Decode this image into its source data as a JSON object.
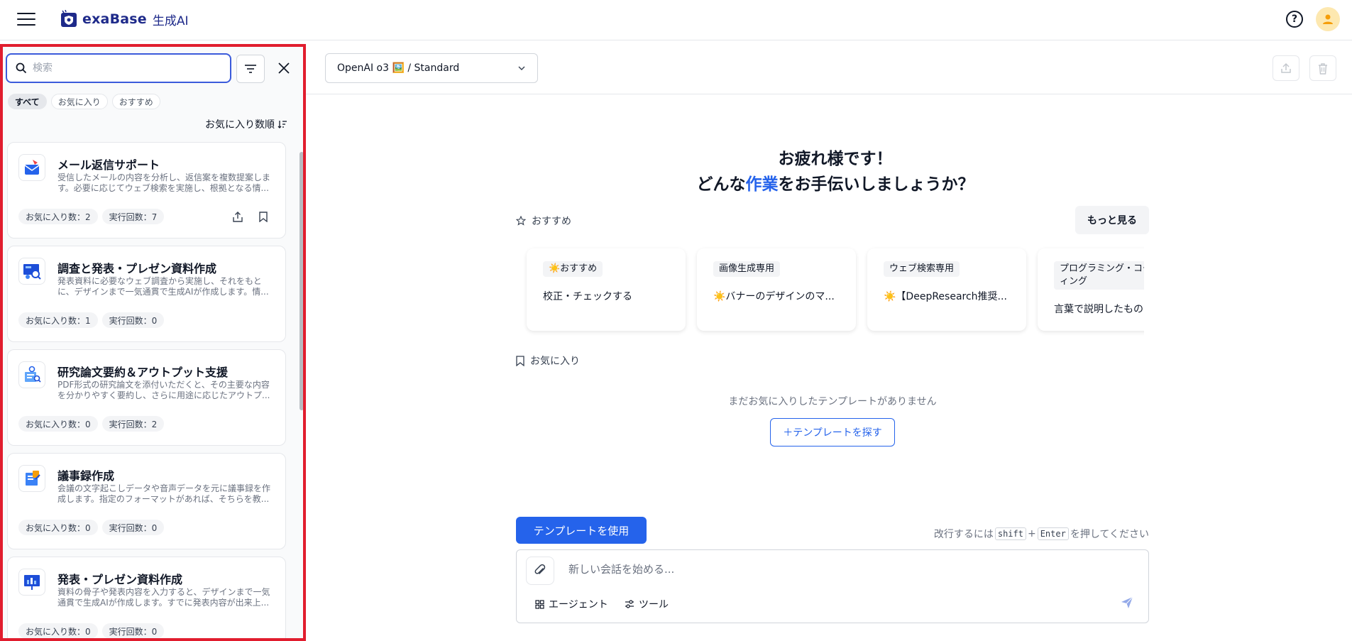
{
  "header": {
    "logo_text": "exaBase",
    "logo_sub": "生成AI",
    "help_label": "?"
  },
  "sidebar": {
    "search_placeholder": "検索",
    "chips": [
      "すべて",
      "お気に入り",
      "おすすめ"
    ],
    "sort_label": "お気に入り数順",
    "cards": [
      {
        "title": "メール返信サポート",
        "desc": "受信したメールの内容を分析し、返信案を複数提案します。必要に応じてウェブ検索を実施し、根拠となる情...",
        "favorites": "お気に入り数：2",
        "runs": "実行回数：7",
        "icon": "mail-icon"
      },
      {
        "title": "調査と発表・プレゼン資料作成",
        "desc": "発表資料に必要なウェブ調査から実施し、それをもとに、デザインまで一気通貫で生成AIが作成します。情...",
        "favorites": "お気に入り数：1",
        "runs": "実行回数：0",
        "icon": "presentation-search-icon"
      },
      {
        "title": "研究論文要約＆アウトプット支援",
        "desc": "PDF形式の研究論文を添付いただくと、その主要な内容を分かりやすく要約し、さらに用途に応じたアウトプ...",
        "favorites": "お気に入り数：0",
        "runs": "実行回数：2",
        "icon": "paper-research-icon"
      },
      {
        "title": "議事録作成",
        "desc": "会議の文字起こしデータや音声データを元に議事録を作成します。指定のフォーマットがあれば、そちらを教...",
        "favorites": "お気に入り数：0",
        "runs": "実行回数：0",
        "icon": "minutes-icon"
      },
      {
        "title": "発表・プレゼン資料作成",
        "desc": "資料の骨子や発表内容を入力すると、デザインまで一気通貫で生成AIが作成します。すでに発表内容が出来上...",
        "favorites": "お気に入り数：0",
        "runs": "実行回数：0",
        "icon": "presentation-icon"
      }
    ]
  },
  "toolbar": {
    "model_label": "OpenAI o3 🖼️ / Standard"
  },
  "main": {
    "greeting_line1": "お疲れ様です！",
    "greeting_pre": "どんな",
    "greeting_accent": "作業",
    "greeting_post": "をお手伝いしましょうか？",
    "recommended_label": "おすすめ",
    "more_label": "もっと見る",
    "rec_cards": [
      {
        "tag": "☀️おすすめ",
        "text": "校正・チェックする"
      },
      {
        "tag": "画像生成専用",
        "text": "☀️バナーのデザインのマ..."
      },
      {
        "tag": "ウェブ検索専用",
        "text": "☀️【DeepResearch推奨..."
      },
      {
        "tag": "プログラミング・コーディング",
        "text": "言葉で説明したもの"
      }
    ],
    "favorites_label": "お気に入り",
    "empty_message": "まだお気に入りしたテンプレートがありません",
    "find_template_label": "＋テンプレートを探す"
  },
  "composer": {
    "use_template_label": "テンプレートを使用",
    "hint_pre": "改行するには",
    "hint_key1": "shift",
    "hint_plus": "+",
    "hint_key2": "Enter",
    "hint_post": "を押してください",
    "placeholder": "新しい会話を始める...",
    "agent_label": "エージェント",
    "tools_label": "ツール"
  },
  "colors": {
    "accent": "#2563eb",
    "highlight_border": "#e11d2e",
    "logo": "#1e2a8a"
  }
}
